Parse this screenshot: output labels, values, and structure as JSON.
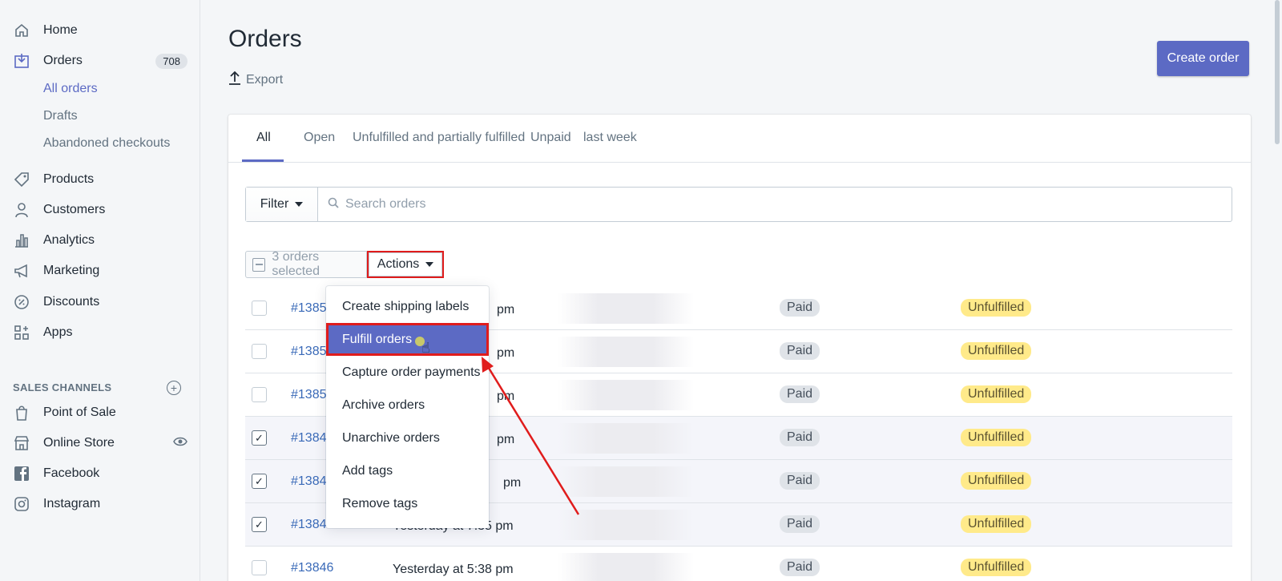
{
  "sidebar": {
    "home": "Home",
    "orders": "Orders",
    "orders_count": "708",
    "all_orders": "All orders",
    "drafts": "Drafts",
    "abandoned": "Abandoned checkouts",
    "products": "Products",
    "customers": "Customers",
    "analytics": "Analytics",
    "marketing": "Marketing",
    "discounts": "Discounts",
    "apps": "Apps",
    "sales_channels_title": "SALES CHANNELS",
    "add_channel": "+",
    "channels": [
      "Point of Sale",
      "Online Store",
      "Facebook",
      "Instagram"
    ]
  },
  "header": {
    "title": "Orders",
    "export": "Export",
    "create_order": "Create order"
  },
  "tabs": [
    "All",
    "Open",
    "Unfulfilled and partially fulfilled",
    "Unpaid",
    "last week"
  ],
  "filter": {
    "filter_label": "Filter",
    "search_placeholder": "Search orders"
  },
  "bulk": {
    "selected_text": "3 orders selected",
    "actions_label": "Actions"
  },
  "dropdown": {
    "items": [
      "Create shipping labels",
      "Fulfill orders",
      "Capture order payments",
      "Archive orders",
      "Unarchive orders",
      "Add tags",
      "Remove tags"
    ],
    "highlighted": "Fulfill orders"
  },
  "rows": [
    {
      "id": "#1385",
      "date": "pm",
      "payment": "Paid",
      "fulfillment": "Unfulfilled",
      "checked": false
    },
    {
      "id": "#1385",
      "date": "pm",
      "payment": "Paid",
      "fulfillment": "Unfulfilled",
      "checked": false
    },
    {
      "id": "#1385(",
      "date": "pm",
      "payment": "Paid",
      "fulfillment": "Unfulfilled",
      "checked": false
    },
    {
      "id": "#1384",
      "date": "pm",
      "payment": "Paid",
      "fulfillment": "Unfulfilled",
      "checked": true
    },
    {
      "id": "#1384",
      "date": "pm",
      "payment": "Paid",
      "fulfillment": "Unfulfilled",
      "checked": true
    },
    {
      "id": "#13847",
      "date": "Yesterday at 7:35 pm",
      "payment": "Paid",
      "fulfillment": "Unfulfilled",
      "checked": true
    },
    {
      "id": "#13846",
      "date": "Yesterday at 5:38 pm",
      "payment": "Paid",
      "fulfillment": "Unfulfilled",
      "checked": false
    }
  ],
  "colors": {
    "accent": "#5c6ac4",
    "highlight_box": "#e01c1c",
    "unfulfilled_badge": "#ffea8a",
    "paid_badge": "#dfe3e8"
  }
}
